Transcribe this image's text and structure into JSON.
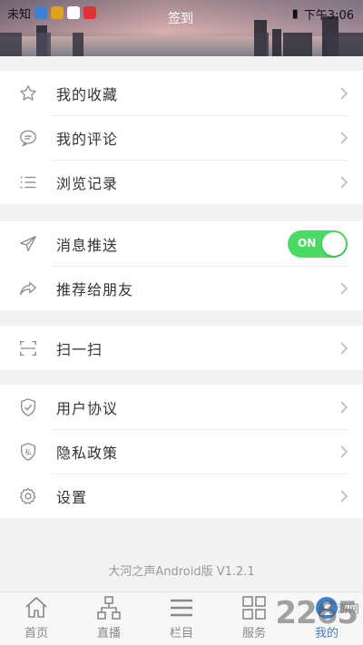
{
  "status_bar": {
    "carrier": "未知",
    "time": "下午3:06"
  },
  "header": {
    "sign_in_label": "签到"
  },
  "sections": [
    {
      "items": [
        {
          "label": "我的收藏",
          "icon": "star-icon"
        },
        {
          "label": "我的评论",
          "icon": "comment-icon"
        },
        {
          "label": "浏览记录",
          "icon": "list-icon"
        }
      ]
    },
    {
      "items": [
        {
          "label": "消息推送",
          "icon": "send-icon",
          "toggle": "ON"
        },
        {
          "label": "推荐给朋友",
          "icon": "share-icon"
        }
      ]
    },
    {
      "items": [
        {
          "label": "扫一扫",
          "icon": "scan-icon"
        }
      ]
    },
    {
      "items": [
        {
          "label": "用户协议",
          "icon": "shield-check-icon"
        },
        {
          "label": "隐私政策",
          "icon": "privacy-shield-icon",
          "icon_text": "私"
        },
        {
          "label": "设置",
          "icon": "gear-icon"
        }
      ]
    }
  ],
  "version": "大河之声Android版 V1.2.1",
  "tabbar": {
    "tabs": [
      {
        "label": "首页",
        "icon": "home-icon"
      },
      {
        "label": "直播",
        "icon": "hierarchy-icon"
      },
      {
        "label": "栏目",
        "icon": "menu-icon"
      },
      {
        "label": "服务",
        "icon": "grid-icon"
      },
      {
        "label": "我的",
        "icon": "user-icon",
        "active": true
      }
    ]
  },
  "watermark": {
    "text": "2265",
    "sub": "手游网"
  },
  "colors": {
    "toggle_on": "#4cd964",
    "active_tab": "#3b82d6",
    "page_bg": "#f2f2f2"
  }
}
